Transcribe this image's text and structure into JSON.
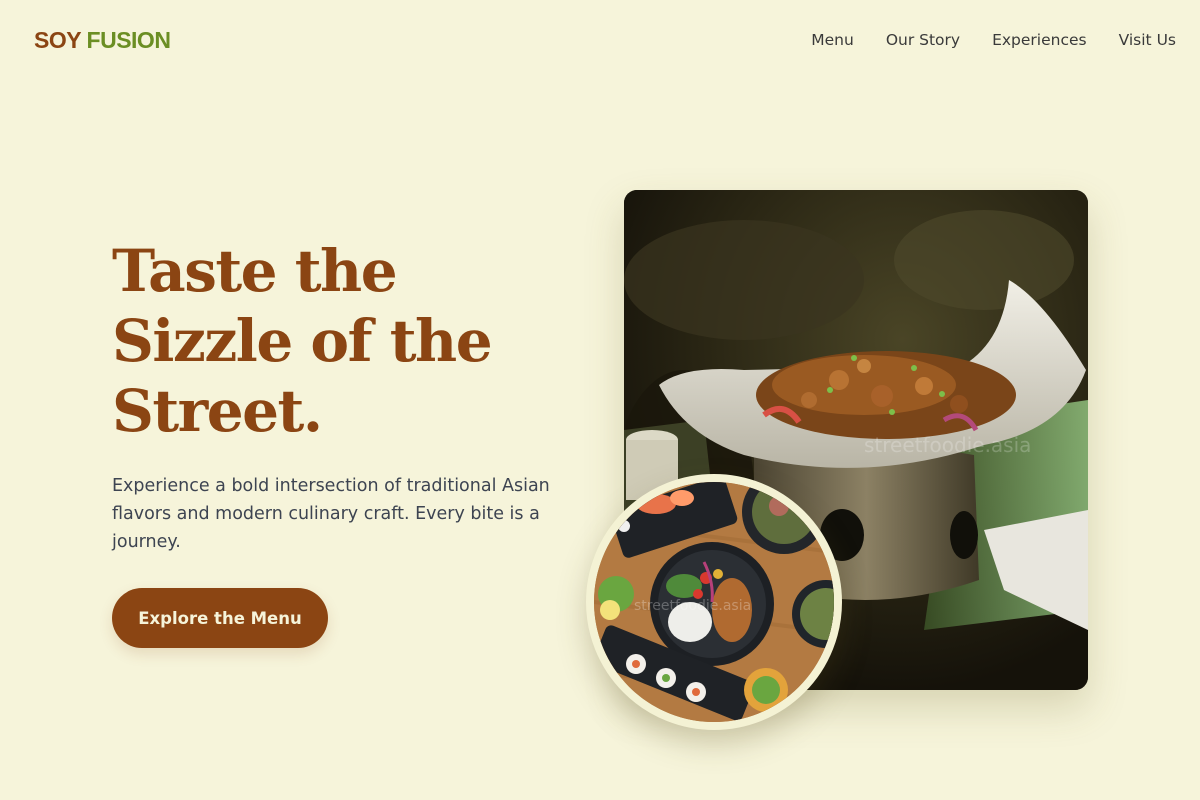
{
  "brand": {
    "part1": "SOY",
    "part2": "FUSION"
  },
  "nav": {
    "items": [
      {
        "label": "Menu"
      },
      {
        "label": "Our Story"
      },
      {
        "label": "Experiences"
      },
      {
        "label": "Visit Us"
      }
    ]
  },
  "hero": {
    "title": "Taste the Sizzle of the Street.",
    "description": "Experience a bold intersection of traditional Asian flavors and modern culinary craft. Every bite is a journey.",
    "cta_label": "Explore the Menu"
  },
  "images": {
    "main_watermark": "streetfoodie.asia",
    "circle_watermark": "streetfoodie.asia"
  },
  "colors": {
    "background": "#f6f4da",
    "brand_brown": "#8b4513",
    "brand_green": "#6b8e23",
    "body_text": "#3d4451"
  }
}
